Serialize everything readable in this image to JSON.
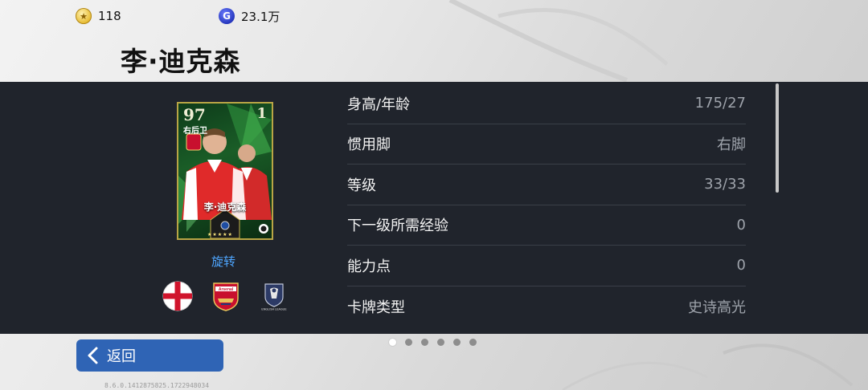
{
  "currency": {
    "coins": "118",
    "gp": "23.1万",
    "gp_symbol": "G"
  },
  "player": {
    "name": "李·迪克森"
  },
  "card": {
    "rating": "97",
    "position": "右后卫",
    "level": "1",
    "name": "李·迪克森",
    "stars": "★★★★★",
    "club_label": "Arsenal",
    "rarity_color": "#1a5d27"
  },
  "rotate_label": "旋转",
  "badges": {
    "nation": "england-flag-icon",
    "club": "arsenal-crest-icon",
    "league": "english-league-icon",
    "club_text": "Arsenal",
    "league_text": "ENGLISH LEAGUE"
  },
  "stats": [
    {
      "label": "身高/年龄",
      "value": "175/27"
    },
    {
      "label": "惯用脚",
      "value": "右脚"
    },
    {
      "label": "等级",
      "value": "33/33"
    },
    {
      "label": "下一级所需经验",
      "value": "0"
    },
    {
      "label": "能力点",
      "value": "0"
    },
    {
      "label": "卡牌类型",
      "value": "史诗高光"
    }
  ],
  "pager": {
    "total": 6,
    "active_index": 0
  },
  "back_label": "返回",
  "version": "8.6.0.1412875825.1722948034",
  "colors": {
    "panel": "#20242c",
    "accent_link": "#4ea6ff",
    "back_button": "#2f64b5"
  }
}
